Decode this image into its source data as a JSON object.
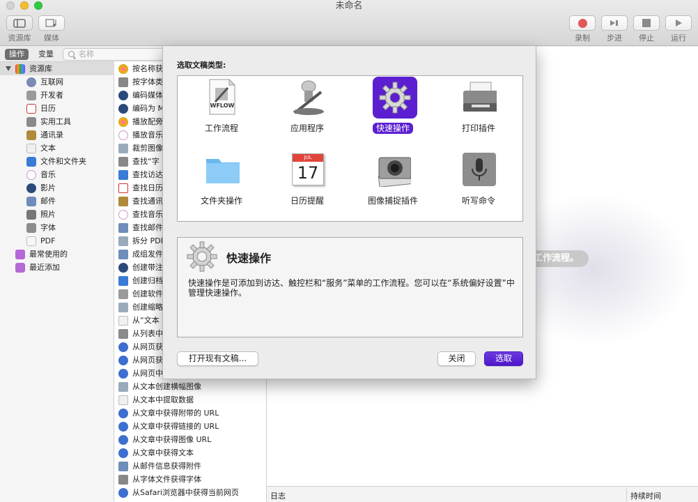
{
  "window": {
    "title": "未命名"
  },
  "toolbar": {
    "library_label": "资源库",
    "media_label": "媒体",
    "record_label": "录制",
    "step_label": "步进",
    "stop_label": "停止",
    "run_label": "运行"
  },
  "library_header": {
    "tab_actions": "操作",
    "tab_variables": "变量",
    "search_placeholder": "名称"
  },
  "library": {
    "root": "资源库",
    "items": [
      "互联网",
      "开发者",
      "日历",
      "实用工具",
      "通讯录",
      "文本",
      "文件和文件夹",
      "音乐",
      "影片",
      "邮件",
      "照片",
      "字体",
      "PDF"
    ],
    "most_used": "最常使用的",
    "recently_added": "最近添加"
  },
  "actions": [
    "按名称获",
    "按字体类",
    "编码媒体",
    "编码为 M",
    "播放配旁",
    "播放音乐",
    "裁剪图像",
    "查找“字",
    "查找访达",
    "查找日历",
    "查找通讯",
    "查找音乐",
    "查找邮件",
    "拆分 PDF",
    "成组发件",
    "创建带注",
    "创建归档",
    "创建软件",
    "创建缩略",
    "从“文本",
    "从列表中",
    "从网页获",
    "从网页获",
    "从网页中",
    "从文本创建横幅图像",
    "从文本中提取数据",
    "从文章中获得附带的 URL",
    "从文章中获得链接的 URL",
    "从文章中获得图像 URL",
    "从文章中获得文本",
    "从邮件信息获得附件",
    "从字体文件获得字体",
    "从Safari浏览器中获得当前网页"
  ],
  "main": {
    "hint": "工作流程。"
  },
  "log_bar": {
    "log": "日志",
    "duration": "持续时间"
  },
  "dialog": {
    "title": "选取文稿类型:",
    "types": [
      {
        "label": "工作流程",
        "icon": "workflow-icon"
      },
      {
        "label": "应用程序",
        "icon": "automator-robot-icon"
      },
      {
        "label": "快速操作",
        "icon": "gear-icon"
      },
      {
        "label": "打印插件",
        "icon": "printer-icon"
      },
      {
        "label": "文件夹操作",
        "icon": "folder-icon"
      },
      {
        "label": "日历提醒",
        "icon": "calendar-icon"
      },
      {
        "label": "图像捕捉插件",
        "icon": "camera-icon"
      },
      {
        "label": "听写命令",
        "icon": "microphone-icon"
      }
    ],
    "calendar_month": "JUL",
    "calendar_day": "17",
    "workflow_text": "WFLOW",
    "selected_index": 2,
    "desc_title": "快速操作",
    "desc_text": "快速操作是可添加到访达、触控栏和“服务”菜单的工作流程。您可以在“系统偏好设置”中管理快速操作。",
    "open_existing": "打开现有文稿...",
    "close": "关闭",
    "choose": "选取"
  },
  "colors": {
    "accent": "#5b1fd1",
    "record": "#e0585a"
  }
}
